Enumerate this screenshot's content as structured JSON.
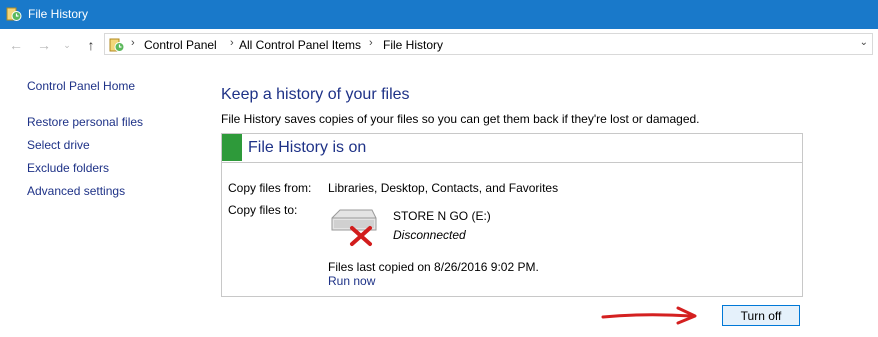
{
  "window": {
    "title": "File History"
  },
  "address_bar": {
    "breadcrumbs": [
      "Control Panel",
      "All Control Panel Items",
      "File History"
    ],
    "separator": "›"
  },
  "nav": {
    "back": "←",
    "forward": "→",
    "recent": "⌄",
    "up": "↑"
  },
  "sidebar": {
    "home": "Control Panel Home",
    "links": [
      "Restore personal files",
      "Select drive",
      "Exclude folders",
      "Advanced settings"
    ]
  },
  "main": {
    "heading": "Keep a history of your files",
    "description": "File History saves copies of your files so you can get them back if they're lost or damaged.",
    "status": {
      "text": "File History is on",
      "color": "#2e9a3a"
    },
    "copy_from_label": "Copy files from:",
    "copy_from_value": "Libraries, Desktop, Contacts, and Favorites",
    "copy_to_label": "Copy files to:",
    "drive_name": "STORE N GO (E:)",
    "drive_status": "Disconnected",
    "last_copied": "Files last copied on 8/26/2016 9:02 PM.",
    "run_now": "Run now",
    "turn_off": "Turn off"
  },
  "colors": {
    "titlebar": "#1979ca",
    "link": "#1e3287",
    "annotation_arrow": "#d42020"
  },
  "icons": {
    "app": "file-history-icon",
    "drive": "drive-disconnected-icon"
  }
}
